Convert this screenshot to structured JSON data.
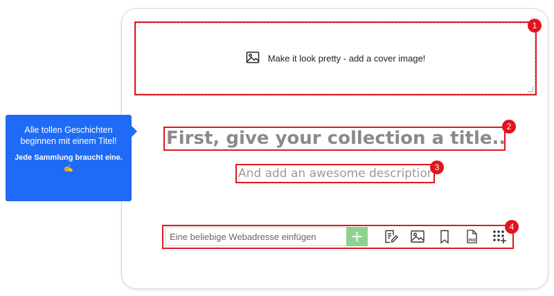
{
  "cover": {
    "label": "Make it look pretty - add a cover image!",
    "icon": "image-icon"
  },
  "title": {
    "placeholder": "First, give your collection a title..."
  },
  "description": {
    "placeholder": "And add an awesome description!"
  },
  "url_bar": {
    "placeholder": "Eine beliebige Webadresse einfügen",
    "add_label": "+",
    "add_color": "#8fd18e"
  },
  "tools": [
    {
      "name": "text-note-icon"
    },
    {
      "name": "image-icon"
    },
    {
      "name": "bookmark-icon"
    },
    {
      "name": "pdf-icon",
      "text": "PDF"
    },
    {
      "name": "more-apps-icon"
    }
  ],
  "tooltip": {
    "main": "Alle tollen Geschichten beginnen mit einem Titel!",
    "sub": "Jede Sammlung braucht eine. ✍",
    "color": "#1f6bf5"
  },
  "annotations": [
    "1",
    "2",
    "3",
    "4"
  ],
  "annotation_color": "#e0161d"
}
